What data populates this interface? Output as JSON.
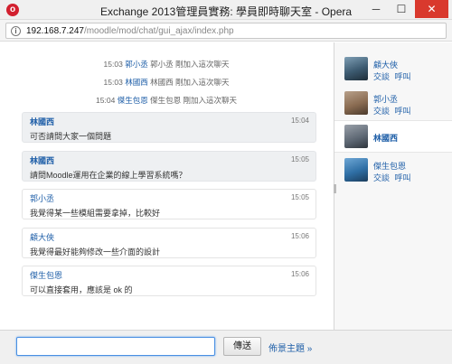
{
  "window": {
    "title": "Exchange 2013管理員實務: 學員即時聊天室 - Opera",
    "app_icon_glyph": "o",
    "min_glyph": "─",
    "max_glyph": "☐",
    "close_glyph": "✕"
  },
  "address": {
    "info_glyph": "i",
    "url_host": "192.168.7.247",
    "url_path": "/moodle/mod/chat/gui_ajax/index.php"
  },
  "system_messages": [
    {
      "time": "15:03",
      "user": "郭小丞",
      "text": "郭小丞 剛加入這次聊天"
    },
    {
      "time": "15:03",
      "user": "林國西",
      "text": "林國西 剛加入這次聊天"
    },
    {
      "time": "15:04",
      "user": "傑生包恩",
      "text": "傑生包恩 剛加入這次聊天"
    }
  ],
  "messages": [
    {
      "name": "林國西",
      "time": "15:04",
      "text": "可否請問大家一個問題",
      "me": true
    },
    {
      "name": "林國西",
      "time": "15:05",
      "text": "請問Moodle運用在企業的線上學習系統嗎？",
      "me": true
    },
    {
      "name": "郭小丞",
      "time": "15:05",
      "text": "我覺得某一些模組需要拿掉，比較好",
      "me": false
    },
    {
      "name": "顧大俠",
      "time": "15:06",
      "text": "我覺得最好能夠修改一些介面的設計",
      "me": false
    },
    {
      "name": "傑生包恩",
      "time": "15:06",
      "text": "可以直接套用，應該是 ok 的",
      "me": false
    }
  ],
  "users": [
    {
      "name": "顧大俠",
      "action1": "交談",
      "action2": "呼叫",
      "current": false
    },
    {
      "name": "郭小丞",
      "action1": "交談",
      "action2": "呼叫",
      "current": false
    },
    {
      "name": "林國西",
      "current": true
    },
    {
      "name": "傑生包恩",
      "action1": "交談",
      "action2": "呼叫",
      "current": false
    }
  ],
  "input": {
    "value": "",
    "placeholder": ""
  },
  "send_label": "傳送",
  "theme_link": "佈景主題 »"
}
